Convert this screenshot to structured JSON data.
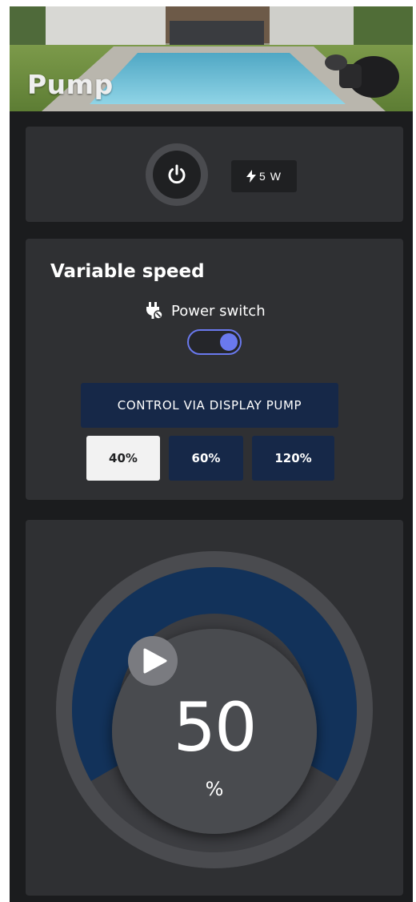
{
  "header": {
    "title": "Pump"
  },
  "power": {
    "icon": "power-icon",
    "consumption": "5 W",
    "consumption_icon": "bolt-icon"
  },
  "variable_speed": {
    "title": "Variable speed",
    "switch_label": "Power switch",
    "switch_icon": "plug-off-icon",
    "switch_on": true,
    "mode_button": "CONTROL VIA DISPLAY PUMP",
    "presets": [
      "40%",
      "60%",
      "120%"
    ],
    "selected_preset": "40%"
  },
  "gauge": {
    "value": "50",
    "unit": "%",
    "level": 0.5,
    "play_icon": "play-icon"
  },
  "colors": {
    "background": "#1b1c1e",
    "card": "#2f3033",
    "accent": "#6a79ee",
    "button_dark_blue": "#162848",
    "gauge_fill": "#12325a"
  }
}
